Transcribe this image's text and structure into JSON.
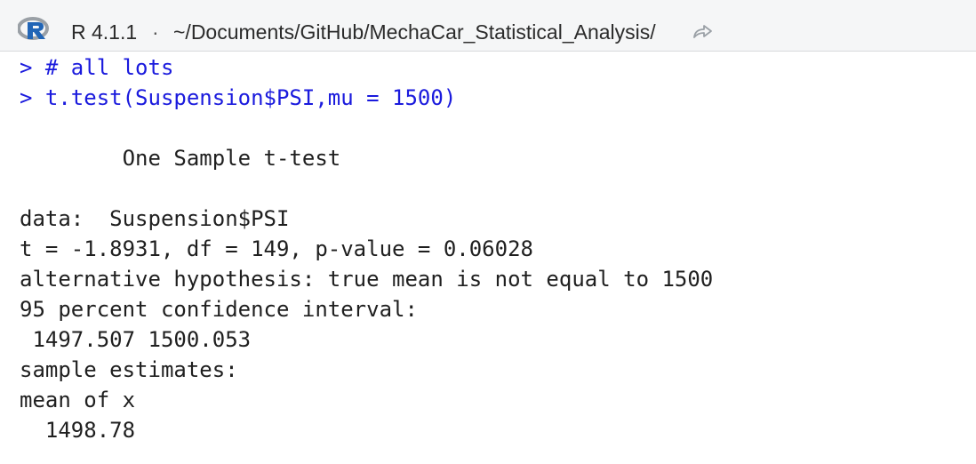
{
  "header": {
    "version": "R 4.1.1",
    "separator": "·",
    "path": "~/Documents/GitHub/MechaCar_Statistical_Analysis/",
    "r_logo_icon": "r-logo-icon",
    "goto_icon": "go-to-directory-icon",
    "accent_color": "#2165b6"
  },
  "console": {
    "command_color": "#1a1add",
    "output_color": "#1f1f1f",
    "commands": [
      "> # all lots",
      "> t.test(Suspension$PSI,mu = 1500)"
    ],
    "title": "        One Sample t-test",
    "data_line": "data:  Suspension$PSI",
    "stat_line": "t = -1.8931, df = 149, p-value = 0.06028",
    "alt_line": "alternative hypothesis: true mean is not equal to 1500",
    "ci_label": "95 percent confidence interval:",
    "ci_values": " 1497.507 1500.053",
    "est_label": "sample estimates:",
    "est_name": "mean of x",
    "est_value": "  1498.78"
  }
}
